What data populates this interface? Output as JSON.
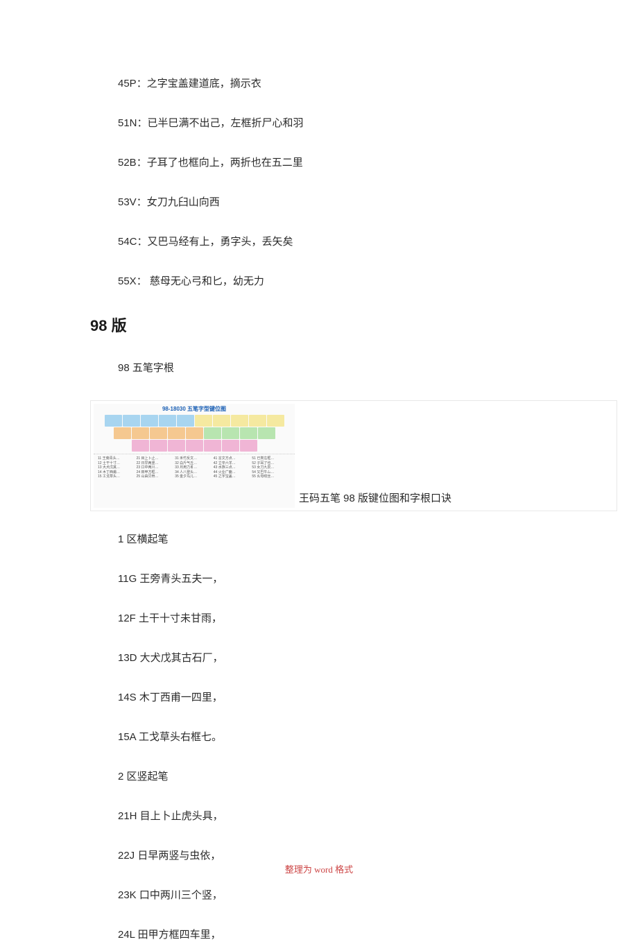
{
  "lines_top": [
    "45P：之字宝盖建道底，摘示衣",
    "51N：已半巳满不出己，左框折尸心和羽",
    "52B：子耳了也框向上，两折也在五二里",
    "53V：女刀九臼山向西",
    "54C：又巴马经有上，勇字头，丢矢矣",
    "55X： 慈母无心弓和匕，幼无力"
  ],
  "heading": "98 版",
  "sub_heading": "98 五笔字根",
  "keyboard": {
    "title": "98-18030 五笔字型键位图",
    "caption": "王码五笔 98 版键位图和字根口诀"
  },
  "lines_bottom": [
    "1 区横起笔",
    "11G 王旁青头五夫一，",
    "12F 土干十寸未甘雨，",
    "13D 大犬戊其古石厂，",
    "14S 木丁西甫一四里，",
    "15A 工戈草头右框七。",
    "2 区竖起笔",
    "21H 目上卜止虎头具，",
    "22J 日早两竖与虫依，",
    "23K 口中两川三个竖，",
    "24L 田甲方框四车里，"
  ],
  "footer": "整理为 word 格式"
}
